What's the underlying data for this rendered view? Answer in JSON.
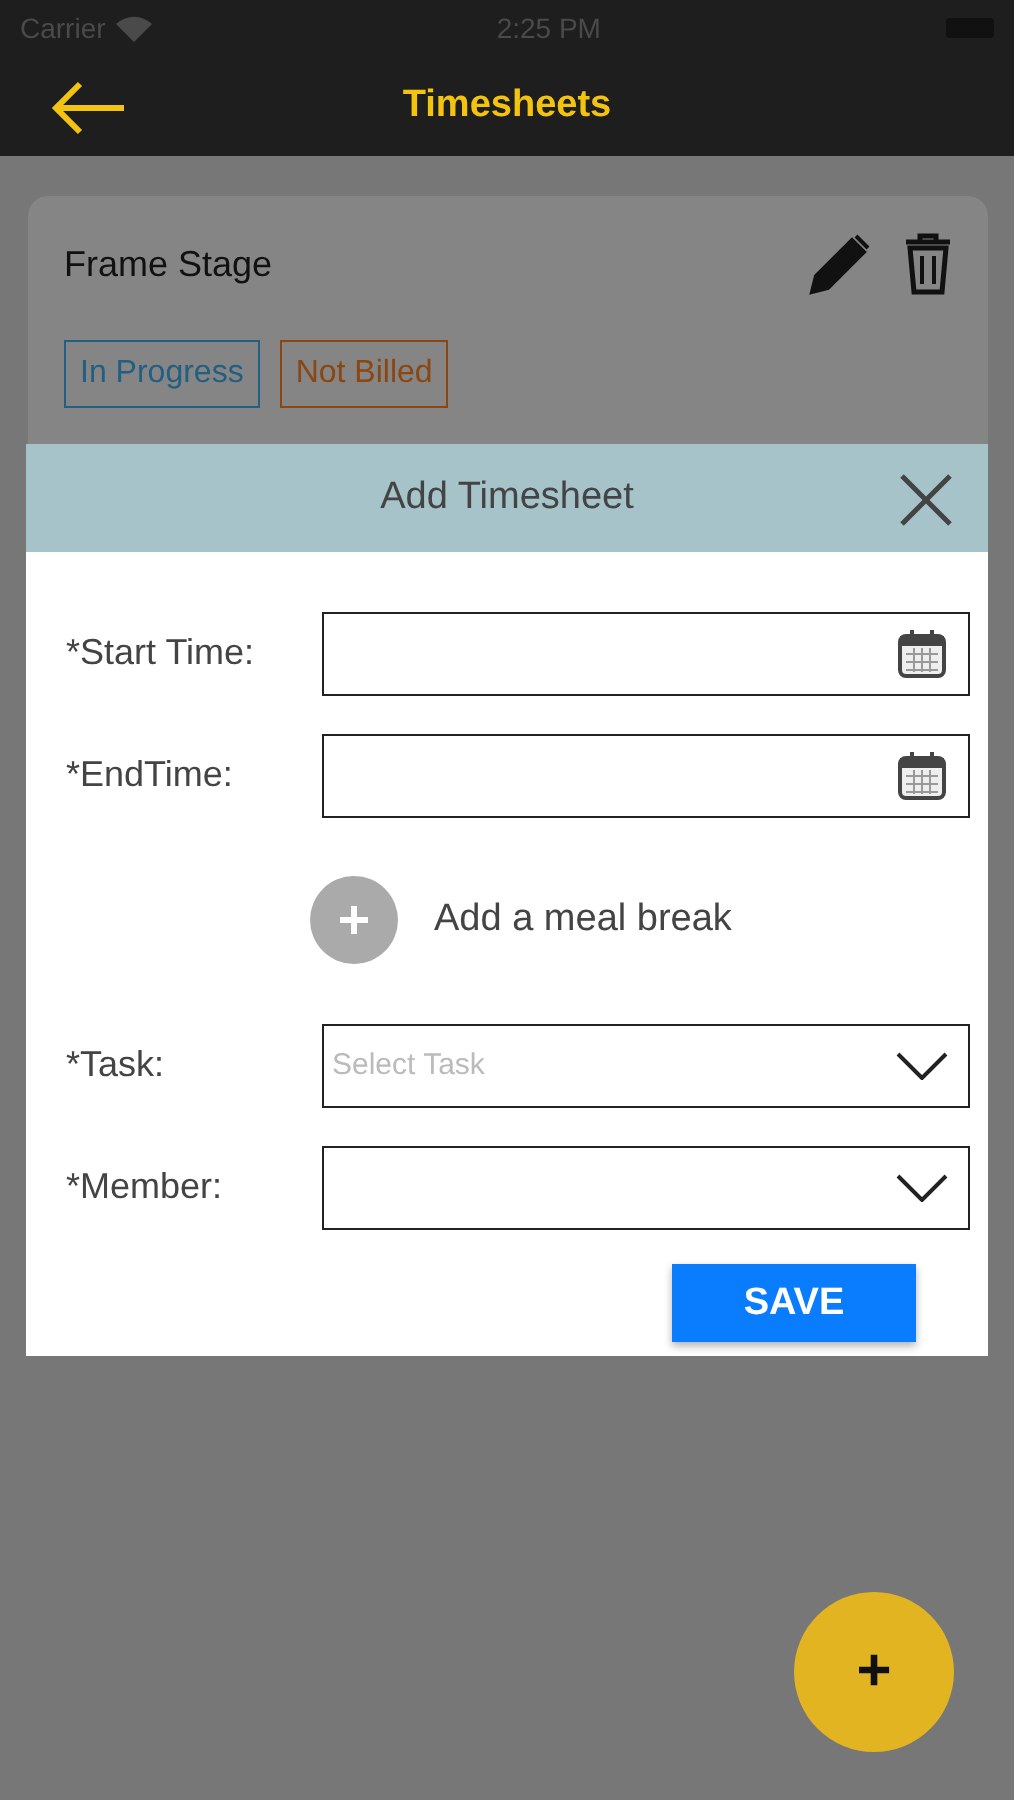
{
  "status_bar": {
    "carrier": "Carrier",
    "time": "2:25 PM"
  },
  "nav": {
    "title": "Timesheets"
  },
  "card": {
    "title": "Frame Stage",
    "tags": [
      {
        "label": "In Progress",
        "color": "#235f80"
      },
      {
        "label": "Not Billed",
        "color": "#8a4712"
      }
    ]
  },
  "dialog": {
    "title": "Add Timesheet",
    "fields": [
      {
        "label": "*Start Time:",
        "kind": "date"
      },
      {
        "label": "*EndTime:",
        "kind": "date"
      },
      {
        "label": "Add a meal break",
        "kind": "action"
      },
      {
        "label": "*Task:",
        "kind": "select",
        "placeholder": "Select Task"
      },
      {
        "label": "*Member:",
        "kind": "select"
      }
    ],
    "save": "SAVE"
  },
  "fab": {
    "label": "+"
  }
}
